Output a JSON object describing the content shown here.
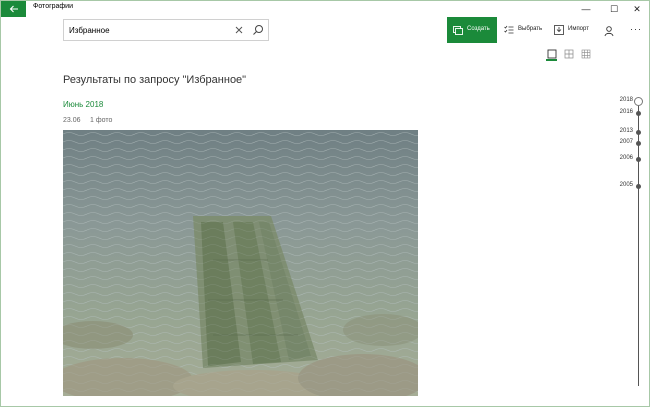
{
  "titlebar": {
    "back_icon": "arrow-left-icon",
    "app_title": "Фотографии",
    "minimize": "—",
    "maximize": "☐",
    "close": "✕"
  },
  "search": {
    "value": "Избранное",
    "clear_icon": "close-icon",
    "submit_icon": "search-icon"
  },
  "toolbar": {
    "create_label": "Создать",
    "select_label": "Выбрать",
    "import_label": "Импорт",
    "account_icon": "person-icon",
    "more_label": "···"
  },
  "view_toggles": [
    "single-view-icon",
    "medium-grid-icon",
    "small-grid-icon"
  ],
  "results": {
    "title": "Результаты по запросу \"Избранное\"",
    "groups": [
      {
        "month": "Июнь 2018",
        "date": "23.06",
        "count": "1 фото"
      }
    ]
  },
  "timeline": {
    "years": [
      "2018",
      "2016",
      "2013",
      "2007",
      "2006",
      "2005"
    ]
  },
  "colors": {
    "accent": "#1b8a3a",
    "window_border": "#a7c8a7"
  }
}
